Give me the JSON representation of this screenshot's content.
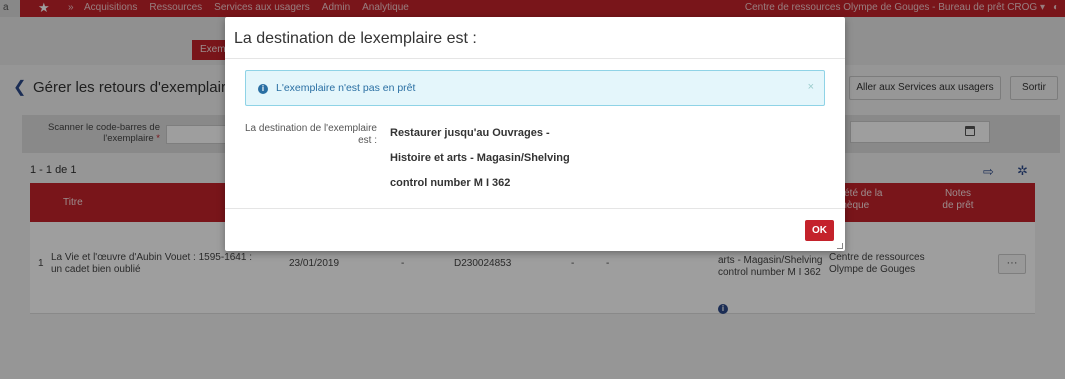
{
  "topnav": {
    "edge_text": "a",
    "menu": [
      "Acquisitions",
      "Ressources",
      "Services aux usagers",
      "Admin",
      "Analytique"
    ],
    "library": "Centre de ressources Olympe de Gouges - Bureau de prêt CROG ▾"
  },
  "subbar": {
    "button": "Exemp"
  },
  "page": {
    "title": "Gérer les retours d'exemplaire",
    "btn_services": "Aller aux Services aux usagers",
    "btn_sortir": "Sortir"
  },
  "scan": {
    "label": "Scanner le code-barres de l'exemplaire",
    "required_mark": "*"
  },
  "results": {
    "count": "1 - 1 de 1"
  },
  "table": {
    "headers": {
      "titre": "Titre",
      "propriete": "oriété de la othèque",
      "notes": "Notes de prêt"
    },
    "row": {
      "num": "1",
      "titre": "La Vie et l'œuvre d'Aubin Vouet : 1595-1641 : un cadet bien oublié",
      "date": "23/01/2019",
      "dash1": "-",
      "barcode": "D230024853",
      "dash2": "-",
      "dash3": "-",
      "dest": "arts - Magasin/Shelving control number M I 362",
      "library": "Centre de ressources Olympe de Gouges",
      "more": "···"
    }
  },
  "modal": {
    "title": "La destination de lexemplaire est :",
    "alert": "L'exemplaire n'est pas en prêt",
    "alert_close": "×",
    "dest_label": "La destination de l'exemplaire est :",
    "dest_lines": [
      "Restaurer jusqu'au Ouvrages -",
      "Histoire et arts - Magasin/Shelving",
      "control number M I 362"
    ],
    "ok": "OK"
  }
}
